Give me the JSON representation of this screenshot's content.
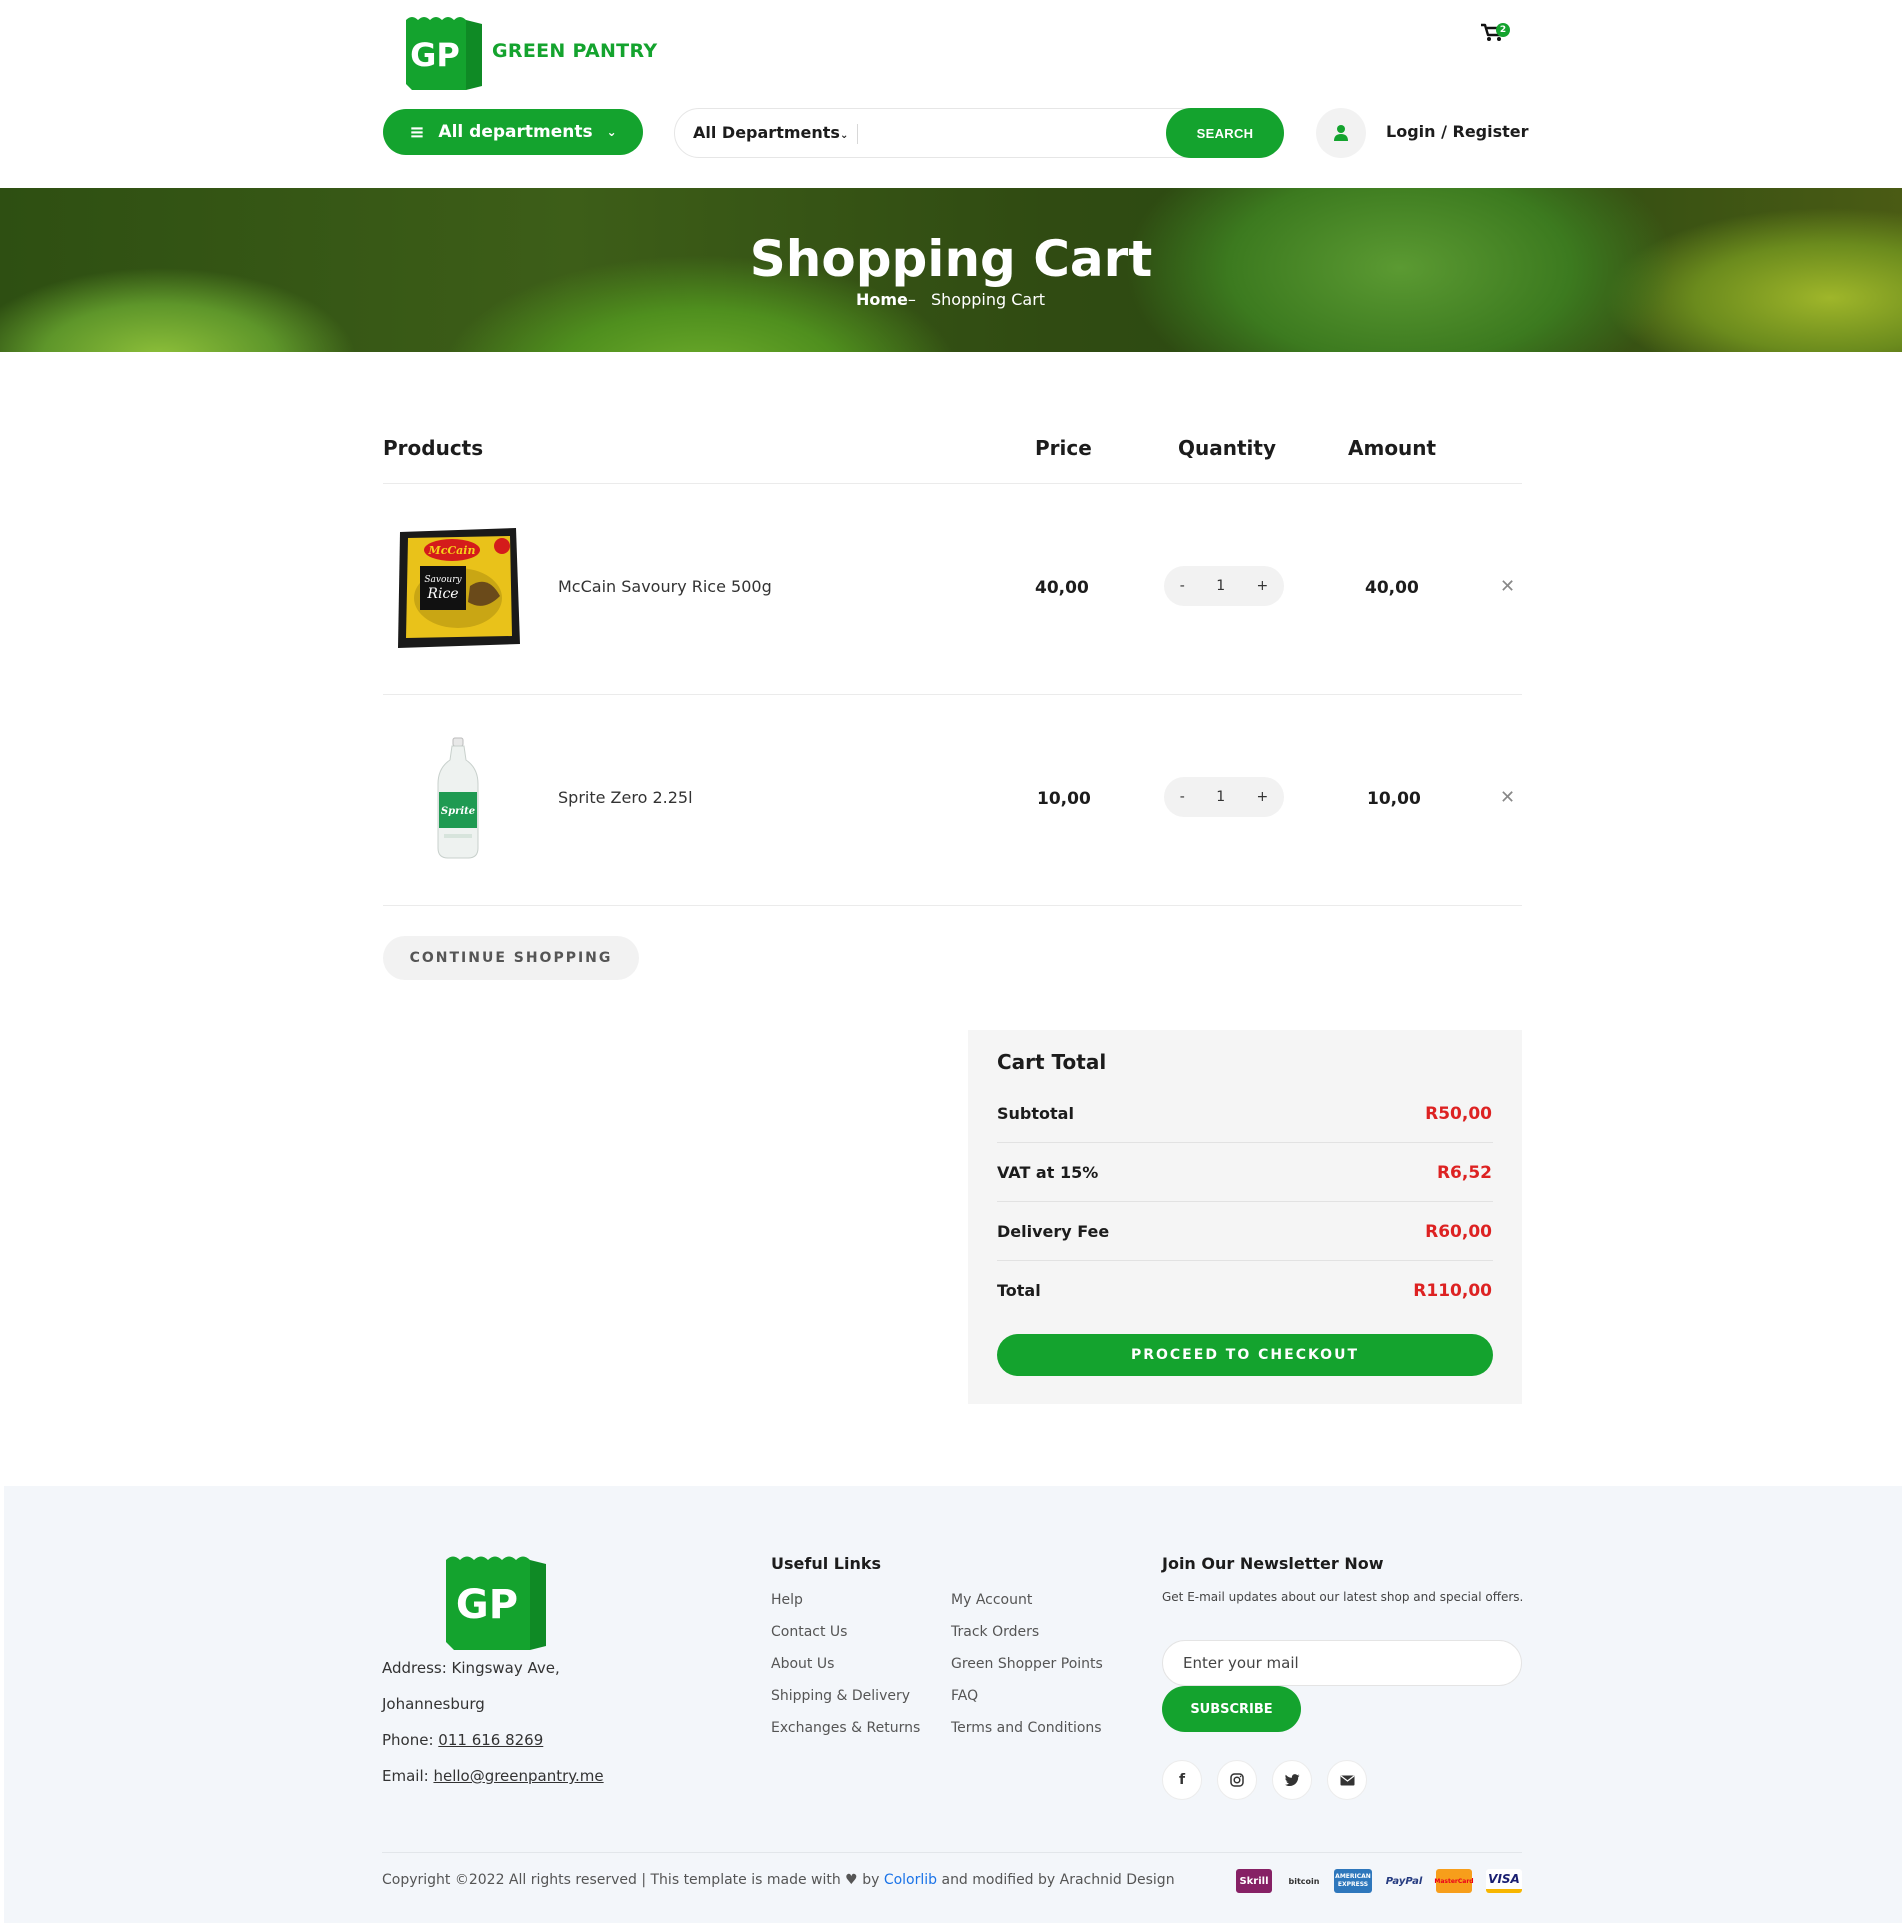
{
  "header": {
    "logo_initials": "GP",
    "brand_name": "GREEN PANTRY",
    "cart_count": "2",
    "departments_button": "All departments",
    "search": {
      "category": "All Departments",
      "placeholder": "",
      "button": "SEARCH"
    },
    "login_register": "Login / Register"
  },
  "hero": {
    "title": "Shopping Cart",
    "breadcrumb_home": "Home",
    "breadcrumb_separator": "–",
    "breadcrumb_current": "Shopping Cart"
  },
  "cart": {
    "columns": {
      "products": "Products",
      "price": "Price",
      "quantity": "Quantity",
      "amount": "Amount"
    },
    "items": [
      {
        "name": "McCain Savoury Rice 500g",
        "price": "40,00",
        "quantity": "1",
        "amount": "40,00",
        "image": "rice-pack"
      },
      {
        "name": "Sprite Zero 2.25l",
        "price": "10,00",
        "quantity": "1",
        "amount": "10,00",
        "image": "soda-bottle"
      }
    ],
    "qty_minus": "-",
    "qty_plus": "+",
    "remove_symbol": "✕",
    "continue_shopping": "CONTINUE SHOPPING"
  },
  "totals": {
    "title": "Cart Total",
    "rows": [
      {
        "label": "Subtotal",
        "value": "R50,00"
      },
      {
        "label": "VAT at 15%",
        "value": "R6,52"
      },
      {
        "label": "Delivery Fee",
        "value": "R60,00"
      },
      {
        "label": "Total",
        "value": "R110,00"
      }
    ],
    "checkout": "PROCEED TO CHECKOUT"
  },
  "footer": {
    "logo_initials": "GP",
    "address_line1": "Address: Kingsway Ave,",
    "address_line2": "Johannesburg",
    "phone_label": "Phone: ",
    "phone": "011 616 8269",
    "email_label": "Email: ",
    "email": "hello@greenpantry.me",
    "useful_links_title": "Useful Links",
    "links_col1": [
      "Help",
      "Contact Us",
      "About Us",
      "Shipping & Delivery",
      "Exchanges & Returns"
    ],
    "links_col2": [
      "My Account",
      "Track Orders",
      "Green Shopper Points",
      "FAQ",
      "Terms and Conditions"
    ],
    "newsletter_title": "Join Our Newsletter Now",
    "newsletter_text": "Get E-mail updates about our latest shop and special offers.",
    "newsletter_placeholder": "Enter your mail",
    "subscribe": "SUBSCRIBE",
    "social": [
      "facebook-icon",
      "instagram-icon",
      "twitter-icon",
      "envelope-icon"
    ],
    "copyright_pre": "Copyright ©2022 All rights reserved | This template is made with",
    "copyright_by": "by",
    "copyright_link": "Colorlib",
    "copyright_post": "and modified by Arachnid Design",
    "payments": [
      "Skrill",
      "bitcoin",
      "AMERICAN EXPRESS",
      "PayPal",
      "MasterCard",
      "VISA"
    ]
  },
  "colors": {
    "brand_green": "#14a32e",
    "price_red": "#dd2222",
    "footer_bg": "#f3f6fa"
  }
}
